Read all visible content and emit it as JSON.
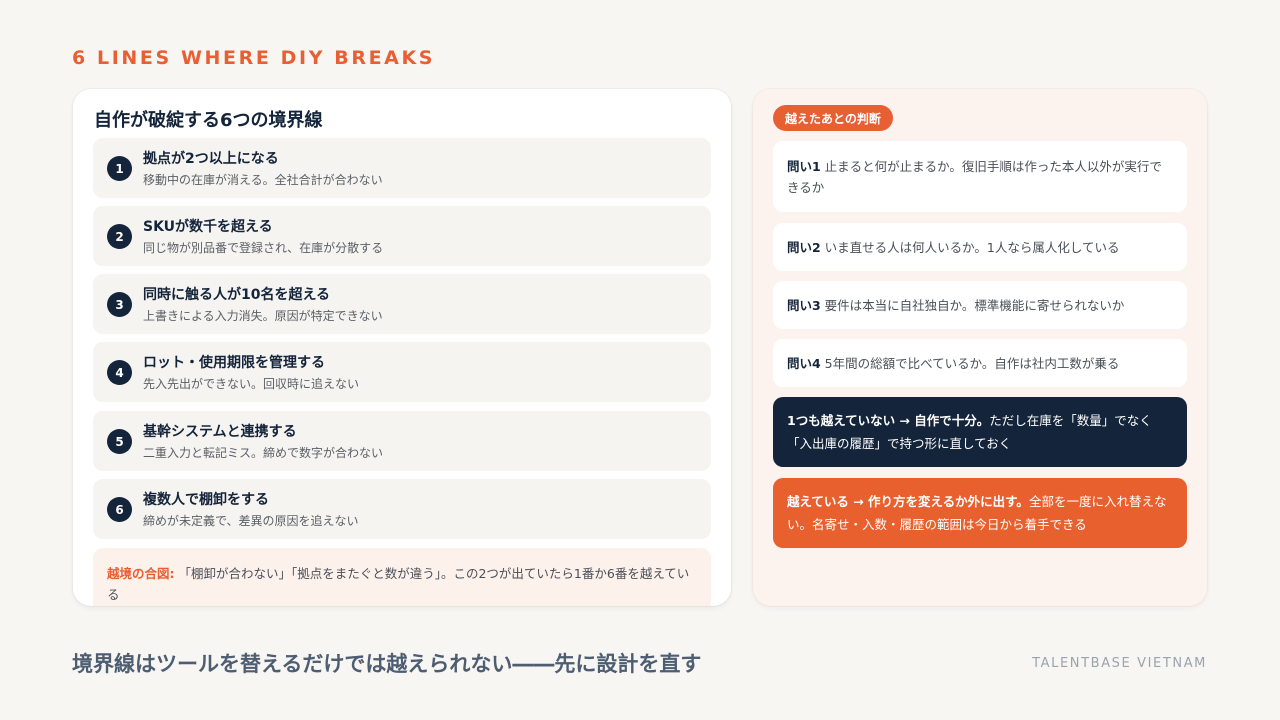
{
  "kicker": "6 LINES WHERE DIY BREAKS",
  "left": {
    "title": "自作が破綻する6つの境界線",
    "items": [
      {
        "num": "1",
        "title": "拠点が2つ以上になる",
        "desc": "移動中の在庫が消える。全社合計が合わない"
      },
      {
        "num": "2",
        "title": "SKUが数千を超える",
        "desc": "同じ物が別品番で登録され、在庫が分散する"
      },
      {
        "num": "3",
        "title": "同時に触る人が10名を超える",
        "desc": "上書きによる入力消失。原因が特定できない"
      },
      {
        "num": "4",
        "title": "ロット・使用期限を管理する",
        "desc": "先入先出ができない。回収時に追えない"
      },
      {
        "num": "5",
        "title": "基幹システムと連携する",
        "desc": "二重入力と転記ミス。締めで数字が合わない"
      },
      {
        "num": "6",
        "title": "複数人で棚卸をする",
        "desc": "締めが未定義で、差異の原因を追えない"
      }
    ],
    "signal_label": "越境の合図:",
    "signal_text": " 「棚卸が合わない」「拠点をまたぐと数が違う」。この2つが出ていたら1番か6番を越えている"
  },
  "right": {
    "pill": "越えたあとの判断",
    "questions": [
      {
        "label": "問い1",
        "text": " 止まると何が止まるか。復旧手順は作った本人以外が実行できるか"
      },
      {
        "label": "問い2",
        "text": " いま直せる人は何人いるか。1人なら属人化している"
      },
      {
        "label": "問い3",
        "text": " 要件は本当に自社独自か。標準機能に寄せられないか"
      },
      {
        "label": "問い4",
        "text": " 5年間の総額で比べているか。自作は社内工数が乗る"
      }
    ],
    "verdict_dark_bold": "1つも越えていない → 自作で十分。",
    "verdict_dark_text": "ただし在庫を「数量」でなく「入出庫の履歴」で持つ形に直しておく",
    "verdict_orange_bold": "越えている → 作り方を変えるか外に出す。",
    "verdict_orange_text": "全部を一度に入れ替えない。名寄せ・入数・履歴の範囲は今日から着手できる"
  },
  "bottom_line": "境界線はツールを替えるだけでは越えられない――先に設計を直す",
  "brand": "TALENTBASE VIETNAM",
  "colors": {
    "accent": "#e85f34",
    "navy": "#14243a",
    "background": "#f8f6f3"
  }
}
